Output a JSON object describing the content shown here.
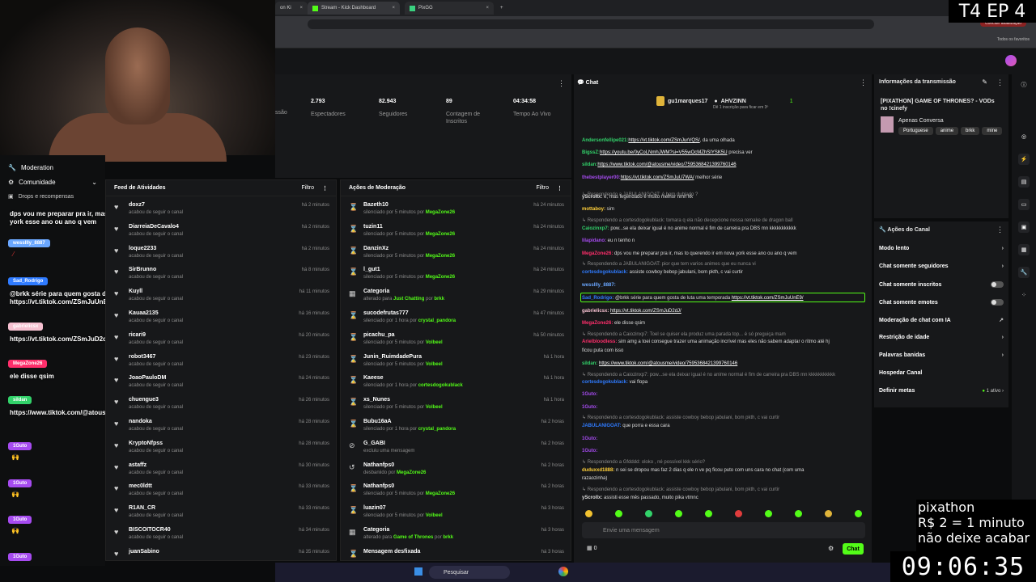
{
  "browser": {
    "tabs": [
      {
        "label": "on Ki"
      },
      {
        "label": "Stream - Kick Dashboard"
      },
      {
        "label": "PixGG"
      }
    ],
    "update_button": "Concluir atualização",
    "bookmarks_label": "Todos os favoritos"
  },
  "overlay": {
    "episode": "T4 EP 4",
    "line1": "pixathon",
    "line2": "R$ 2 = 1 minuto",
    "line3": "não deixe acabar",
    "timer": "09:06:35"
  },
  "moderation": {
    "title": "Moderation",
    "community": "Comunidade",
    "drops": "Drops e recompensas",
    "messages": [
      {
        "user": "",
        "text": "dps vou me preparar pra ir, mas to querendo ir em nova york esse ano ou ano q vem",
        "color": "#444"
      },
      {
        "user": "wessllly_8887",
        "text": "",
        "color": "#6aa7ff"
      },
      {
        "user": "Sad_Rodrigo",
        "text": "@brkk série para quem gosta de luta uma temporada https://vt.tiktok.com/ZSmJuUnE9/",
        "color": "#2f7bff"
      },
      {
        "user": "gabrielicsx",
        "text": "https://vt.tiktok.com/ZSmJuD2dJ/",
        "color": "#f6c1d1"
      },
      {
        "user": "MegaZone26",
        "text": "ele disse qsim",
        "color": "#ff2e6b"
      },
      {
        "user": "sildan",
        "text": "https://www.tiktok.com/@atousme/video/7595368421399760146",
        "color": "#32d26a"
      },
      {
        "user": "1Guto",
        "text": "",
        "color": "#a64bf0"
      },
      {
        "user": "1Guto",
        "text": "",
        "color": "#a64bf0"
      },
      {
        "user": "1Guto",
        "text": "",
        "color": "#a64bf0"
      },
      {
        "user": "1Guto",
        "text": "",
        "color": "#a64bf0"
      }
    ]
  },
  "stats": {
    "items": [
      {
        "value": "",
        "label": "ssão"
      },
      {
        "value": "2.793",
        "label": "Espectadores"
      },
      {
        "value": "82.943",
        "label": "Seguidores"
      },
      {
        "value": "89",
        "label": "Contagem de Inscritos"
      },
      {
        "value": "04:34:58",
        "label": "Tempo Ao Vivo"
      }
    ]
  },
  "activity": {
    "title": "Feed de Atividades",
    "filter": "Filtro",
    "rows": [
      {
        "name": "doxz7",
        "sub": "acabou de seguir o canal",
        "time": "há 2 minutos"
      },
      {
        "name": "DiarreiaDeCavalo4",
        "sub": "acabou de seguir o canal",
        "time": "há 2 minutos"
      },
      {
        "name": "loque2233",
        "sub": "acabou de seguir o canal",
        "time": "há 2 minutos"
      },
      {
        "name": "SirBrunno",
        "sub": "acabou de seguir o canal",
        "time": "há 8 minutos"
      },
      {
        "name": "Kuyll",
        "sub": "acabou de seguir o canal",
        "time": "há 11 minutos"
      },
      {
        "name": "Kauaa2135",
        "sub": "acabou de seguir o canal",
        "time": "há 16 minutos"
      },
      {
        "name": "ricari9",
        "sub": "acabou de seguir o canal",
        "time": "há 20 minutos"
      },
      {
        "name": "robot3467",
        "sub": "acabou de seguir o canal",
        "time": "há 23 minutos"
      },
      {
        "name": "JoaoPauloDM",
        "sub": "acabou de seguir o canal",
        "time": "há 24 minutos"
      },
      {
        "name": "chuengue3",
        "sub": "acabou de seguir o canal",
        "time": "há 26 minutos"
      },
      {
        "name": "nandoka",
        "sub": "acabou de seguir o canal",
        "time": "há 28 minutos"
      },
      {
        "name": "KryptoNfpss",
        "sub": "acabou de seguir o canal",
        "time": "há 28 minutos"
      },
      {
        "name": "astaffz",
        "sub": "acabou de seguir o canal",
        "time": "há 30 minutos"
      },
      {
        "name": "mec0ldtt",
        "sub": "acabou de seguir o canal",
        "time": "há 33 minutos"
      },
      {
        "name": "R1AN_CR",
        "sub": "acabou de seguir o canal",
        "time": "há 33 minutos"
      },
      {
        "name": "BISCOITOCR40",
        "sub": "acabou de seguir o canal",
        "time": "há 34 minutos"
      },
      {
        "name": "juanSabino",
        "sub": "",
        "time": "há 35 minutos"
      }
    ]
  },
  "modactions": {
    "title": "Ações de Moderação",
    "filter": "Filtro",
    "rows": [
      {
        "icon": "⌛",
        "name": "Bazeth10",
        "sub": "silenciado por 5 minutos por",
        "by": "MegaZone26",
        "time": "há 24 minutos"
      },
      {
        "icon": "⌛",
        "name": "tuzin11",
        "sub": "silenciado por 5 minutos por",
        "by": "MegaZone26",
        "time": "há 24 minutos"
      },
      {
        "icon": "⌛",
        "name": "DanzinXz",
        "sub": "silenciado por 5 minutos por",
        "by": "MegaZone26",
        "time": "há 24 minutos"
      },
      {
        "icon": "⌛",
        "name": "l_gut1",
        "sub": "silenciado por 5 minutos por",
        "by": "MegaZone26",
        "time": "há 24 minutos"
      },
      {
        "icon": "▦",
        "name": "Categoria",
        "sub": "alterado para",
        "by": "Just Chatting",
        "by2": "brkk",
        "time": "há 29 minutos"
      },
      {
        "icon": "⌛",
        "name": "sucodefrutas777",
        "sub": "silenciado por 1 hora por",
        "by": "crystal_pandora",
        "time": "há 47 minutos"
      },
      {
        "icon": "⌛",
        "name": "picachu_pa",
        "sub": "silenciado por 5 minutos por",
        "by": "Volbeel",
        "time": "há 50 minutos"
      },
      {
        "icon": "⌛",
        "name": "Junin_RuimdadePura",
        "sub": "silenciado por 5 minutos por",
        "by": "Volbeel",
        "time": "há 1 hora"
      },
      {
        "icon": "⌛",
        "name": "Kaeese",
        "sub": "silenciado por 1 hora por",
        "by": "cortesdogokublack",
        "time": "há 1 hora"
      },
      {
        "icon": "⌛",
        "name": "xs_Nunes",
        "sub": "silenciado por 5 minutos por",
        "by": "Volbeel",
        "time": "há 1 hora"
      },
      {
        "icon": "⌛",
        "name": "Bubu16aA",
        "sub": "silenciado por 1 hora por",
        "by": "crystal_pandora",
        "time": "há 2 horas"
      },
      {
        "icon": "⊘",
        "name": "G_GABI",
        "sub": "excluiu uma mensagem",
        "by": "",
        "time": "há 2 horas"
      },
      {
        "icon": "↺",
        "name": "Nathanfps0",
        "sub": "desbaniido por",
        "by": "MegaZone26",
        "time": "há 2 horas"
      },
      {
        "icon": "⌛",
        "name": "Nathanfps0",
        "sub": "silenciado por 5 minutos por",
        "by": "MegaZone26",
        "time": "há 2 horas"
      },
      {
        "icon": "⌛",
        "name": "luazin07",
        "sub": "silenciado por 5 minutos por",
        "by": "Volbeel",
        "time": "há 3 horas"
      },
      {
        "icon": "▦",
        "name": "Categoria",
        "sub": "alterado para",
        "by": "Game of Thrones",
        "by2": "brkk",
        "time": "há 3 horas"
      },
      {
        "icon": "⌛",
        "name": "Mensagem desfixada",
        "sub": "",
        "by": "",
        "time": "há 3 horas"
      }
    ]
  },
  "chat": {
    "title": "Chat",
    "top_user": "gu1marques17",
    "top_user2": "AHVZINN",
    "top_count": "1",
    "top_note": "Dê 1 inscrição para ficar em 3º",
    "input_placeholder": "Envie uma mensagem",
    "send": "Chat",
    "points": "0",
    "lines": [
      {
        "u": "",
        "c": "#a64bf0",
        "t": ""
      },
      {
        "u": "Andersonfellipe021:",
        "c": "#32d26a",
        "t": "",
        "link": "https://vt.tiktok.com/ZSmJurVQS/",
        "after": ", da uma olhada"
      },
      {
        "u": "BigssZ:",
        "c": "#32d26a",
        "t": "",
        "link": "https://youtu.be/0yCoLNmhJWM?si=V55wOcMZhSIYSK5U",
        "after": " precisa ver"
      },
      {
        "u": "sildan:",
        "c": "#32d26a",
        "t": "",
        "link": "https://www.tiktok.com/@atousme/video/7595368421399760146",
        "after": ""
      },
      {
        "u": "thebestplayer00:",
        "c": "#a64bf0",
        "t": "",
        "link": "https://vt.tiktok.com/ZSmJuU7WA/",
        "after": " melhor série"
      },
      {
        "u": "",
        "c": "#888",
        "t": "↳ Respondendo a JABULANIGOAT: é bom dublado ?",
        "reply": true
      },
      {
        "u": "yScrollx:",
        "c": "#ddd",
        "t": " é, mas legendado é muito melhor nmrl kk"
      },
      {
        "u": "mottaboy:",
        "c": "#ffcf3a",
        "t": " sim"
      },
      {
        "u": "",
        "c": "#888",
        "t": "↳ Respondendo a cortesdogokublack: tomara q ela não decepcione nessa remake de dragon ball",
        "reply": true
      },
      {
        "u": "Caiozinxp7:",
        "c": "#32d26a",
        "t": " pow...se ela deixar igual é no anime normal é fim de carreira pra DBS mn kkkkkkkkkkk"
      },
      {
        "u": "lilapidano:",
        "c": "#a64bf0",
        "t": " eu n tenho n"
      },
      {
        "u": "MegaZone26:",
        "c": "#ff2e6b",
        "t": " dps vou me preparar pra ir, mas to querendo ir em nova york esse ano ou ano q vem"
      },
      {
        "u": "",
        "c": "#888",
        "t": "↳ Respondendo a JABULANIGOAT: pior que tem varios animes que eu nunca vi",
        "reply": true
      },
      {
        "u": "cortesdogokublack:",
        "c": "#2f7bff",
        "t": " assiste cowboy bebop jabulani, bom pkth, c vai curtir"
      },
      {
        "u": "wessllly_8887:",
        "c": "#6aa7ff",
        "t": ""
      },
      {
        "u": "Sad_Rodrigo:",
        "c": "#2f7bff",
        "t": " @brkk série para quem gosta de luta uma temporada ",
        "link": "https://vt.tiktok.com/ZSmJuUnE9/",
        "after": ""
      },
      {
        "u": "gabrielicsx:",
        "c": "#f6c1d1",
        "t": " ",
        "link": "https://vt.tiktok.com/ZSmJuD2dJ/",
        "after": ""
      },
      {
        "u": "MegaZone26:",
        "c": "#ff2e6b",
        "t": " ele disse qsim"
      },
      {
        "u": "",
        "c": "#888",
        "t": "↳ Respondendo a Caiozinxp7: Toel se quiser ela produz uma parada top... é só preguiça mam",
        "reply": true
      },
      {
        "u": "Arielbloodless:",
        "c": "#ff2e6b",
        "t": " sim amg a toei consegue trazer uma animação incrível mas eles não sabem adaptar o ritmo até hj"
      },
      {
        "u": "",
        "c": "#ddd",
        "t": "ficou puta com isso"
      },
      {
        "u": "sildan:",
        "c": "#32d26a",
        "t": " ",
        "link": "https://www.tiktok.com/@atousme/video/7595368421399760146",
        "after": ""
      },
      {
        "u": "",
        "c": "#888",
        "t": "↳ Respondendo a Caiozinxp7: pow...se ela deixar igual é no anime normal é fim de carreira pra DBS mn kkkkkkkkkkk",
        "reply": true
      },
      {
        "u": "cortesdogokublack:",
        "c": "#2f7bff",
        "t": " vai flopa"
      },
      {
        "u": "1Guto:",
        "c": "#a64bf0",
        "t": ""
      },
      {
        "u": "1Guto:",
        "c": "#a64bf0",
        "t": ""
      },
      {
        "u": "",
        "c": "#888",
        "t": "↳ Respondendo a cortesdogokublack: assiste cowboy bebop jabulani, bom pkth, c vai curtir",
        "reply": true
      },
      {
        "u": "JABULANIGOAT:",
        "c": "#2f7bff",
        "t": " que porra e essa cara"
      },
      {
        "u": "1Guto:",
        "c": "#a64bf0",
        "t": ""
      },
      {
        "u": "1Guto:",
        "c": "#a64bf0",
        "t": ""
      },
      {
        "u": "",
        "c": "#888",
        "t": "↳ Respondendo a Gfdddd: oloko , né possível kkk sério?",
        "reply": true
      },
      {
        "u": "duduxxd1888:",
        "c": "#ffcf3a",
        "t": " n sei se dropou mas faz 2 dias q ele n ve pq ficou puto com uns cara no chat (com uma"
      },
      {
        "u": "",
        "c": "#ddd",
        "t": "razaozinha)"
      },
      {
        "u": "",
        "c": "#888",
        "t": "↳ Respondendo a cortesdogokublack: assiste cowboy bebop jabulani, bom pkth, c vai curtir",
        "reply": true
      },
      {
        "u": "yScrollx:",
        "c": "#ddd",
        "t": " assisti esse mês passado, muito pika vtmnc"
      }
    ]
  },
  "info": {
    "title": "Informações da transmissão",
    "stream_title": "[PIXATHON] GAME OF THRONES? - VODs no !cinefy",
    "category": "Apenas Conversa",
    "tags": [
      "Portuguese",
      "anime",
      "brkk",
      "mine"
    ]
  },
  "actions": {
    "title": "Ações do Canal",
    "items": [
      {
        "label": "Modo lento",
        "kind": "chevron"
      },
      {
        "label": "Chat somente seguidores",
        "kind": "chevron"
      },
      {
        "label": "Chat somente inscritos",
        "kind": "toggle"
      },
      {
        "label": "Chat somente emotes",
        "kind": "toggle"
      },
      {
        "label": "Moderação de chat com IA",
        "kind": "ext"
      },
      {
        "label": "Restrição de idade",
        "kind": "chevron"
      },
      {
        "label": "Palavras banidas",
        "kind": "chevron"
      },
      {
        "label": "Hospedar Canal",
        "kind": "none"
      },
      {
        "label": "Definir metas",
        "kind": "meta",
        "extra": "1 ativo"
      }
    ]
  },
  "taskbar": {
    "search": "Pesquisar"
  },
  "colors": {
    "kick_green": "#53fc18",
    "panel": "#17181a"
  }
}
